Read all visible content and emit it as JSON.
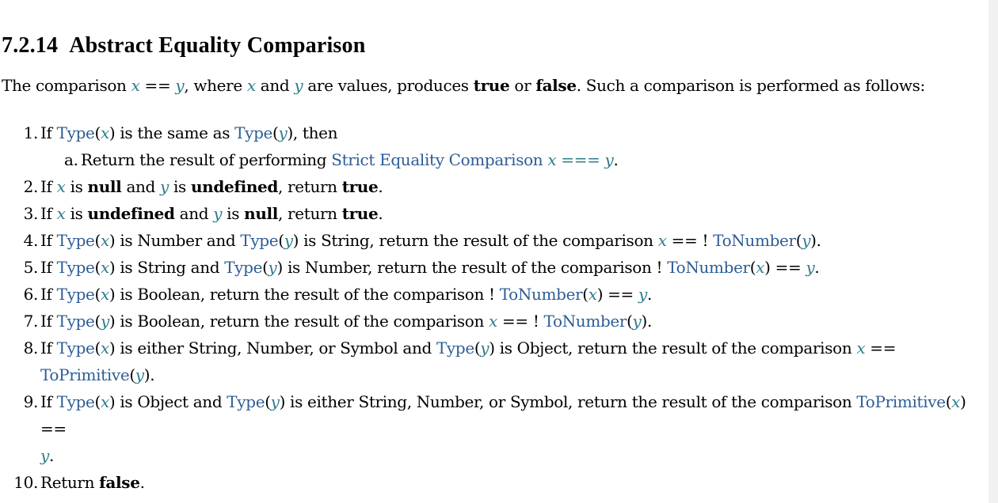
{
  "heading": {
    "number": "7.2.14",
    "title": "Abstract Equality Comparison"
  },
  "intro": {
    "t1": "The comparison ",
    "x": "x",
    "op": " == ",
    "y": "y",
    "t2": ", where ",
    "t3": " and ",
    "t4": " are values, produces ",
    "true": "true",
    "t5": " or ",
    "false": "false",
    "t6": ". Such a comparison is performed as follows:"
  },
  "steps": {
    "s1": {
      "num": "1.",
      "t1": "If ",
      "type": "Type",
      "x": "x",
      "t2": " is the same as ",
      "y": "y",
      "t3": ", then",
      "a": {
        "num": "a.",
        "t1": "Return the result of performing ",
        "link": "Strict Equality Comparison",
        "op": " === ",
        "t2": "."
      }
    },
    "s2": {
      "num": "2.",
      "t1": "If ",
      "x": "x",
      "t2": " is ",
      "b1": "null",
      "t3": " and ",
      "y": "y",
      "t4": " is ",
      "b2": "undefined",
      "t5": ", return ",
      "b3": "true",
      "t6": "."
    },
    "s3": {
      "num": "3.",
      "t1": "If ",
      "x": "x",
      "t2": " is ",
      "b1": "undefined",
      "t3": " and ",
      "y": "y",
      "t4": " is ",
      "b2": "null",
      "t5": ", return ",
      "b3": "true",
      "t6": "."
    },
    "s4": {
      "num": "4.",
      "t1": "If ",
      "type": "Type",
      "x": "x",
      "t2": " is Number and ",
      "y": "y",
      "t3": " is String, return the result of the comparison ",
      "op": " == ! ",
      "tonum": "ToNumber",
      "t4": "."
    },
    "s5": {
      "num": "5.",
      "t1": "If ",
      "type": "Type",
      "x": "x",
      "t2": " is String and ",
      "y": "y",
      "t3": " is Number, return the result of the comparison ! ",
      "tonum": "ToNumber",
      "op": " == ",
      "t4": "."
    },
    "s6": {
      "num": "6.",
      "t1": "If ",
      "type": "Type",
      "x": "x",
      "t2": " is Boolean, return the result of the comparison ! ",
      "tonum": "ToNumber",
      "op": " == ",
      "y": "y",
      "t3": "."
    },
    "s7": {
      "num": "7.",
      "t1": "If ",
      "type": "Type",
      "y": "y",
      "t2": " is Boolean, return the result of the comparison ",
      "x": "x",
      "op": " == ! ",
      "tonum": "ToNumber",
      "t3": "."
    },
    "s8": {
      "num": "8.",
      "t1": "If ",
      "type": "Type",
      "x": "x",
      "t2": " is either String, Number, or Symbol and ",
      "y": "y",
      "t3": " is Object, return the result of the comparison ",
      "op": " ==",
      "toprim": "ToPrimitive",
      "t4": "."
    },
    "s9": {
      "num": "9.",
      "t1": "If ",
      "type": "Type",
      "x": "x",
      "t2": " is Object and ",
      "y": "y",
      "t3": " is either String, Number, or Symbol, return the result of the comparison ",
      "toprim": "ToPrimitive",
      "op": " ==",
      "t4": "."
    },
    "s10": {
      "num": "10.",
      "t1": "Return ",
      "b1": "false",
      "t2": "."
    }
  },
  "paren_open": "(",
  "paren_close": ")"
}
